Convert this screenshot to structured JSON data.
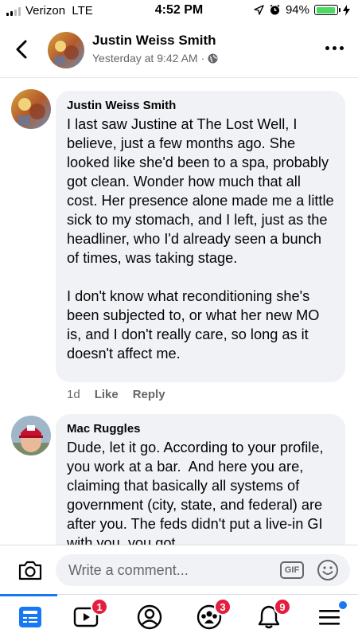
{
  "status_bar": {
    "carrier": "Verizon",
    "network": "LTE",
    "time": "4:52 PM",
    "battery": "94%",
    "battery_level": 0.94
  },
  "header": {
    "name": "Justin Weiss Smith",
    "timestamp": "Yesterday at 9:42 AM",
    "separator": "·",
    "privacy_icon": "globe-icon"
  },
  "comments": [
    {
      "author": "Justin Weiss Smith",
      "text": "I last saw Justine at The Lost Well, I believe, just a few months ago. She looked like she'd been to a spa, probably got clean. Wonder how much that all cost. Her presence alone made me a little sick to my stomach, and I left, just as the headliner, who I'd already seen a bunch of times, was taking stage.\n\nI don't know what reconditioning she's been subjected to, or what her new MO is, and I don't really care, so long as it doesn't affect me.",
      "age": "1d",
      "like_label": "Like",
      "reply_label": "Reply"
    },
    {
      "author": "Mac Ruggles",
      "text": "Dude, let it go. According to your profile, you work at a bar.  And here you are, claiming that basically all systems of government (city, state, and federal) are after you. The feds didn't put a live-in GI with you, you got"
    }
  ],
  "composer": {
    "placeholder": "Write a comment...",
    "gif_label": "GIF"
  },
  "tabbar": {
    "tabs": [
      {
        "icon": "news-feed-icon",
        "badge": ""
      },
      {
        "icon": "watch-icon",
        "badge": "1"
      },
      {
        "icon": "profile-icon",
        "badge": ""
      },
      {
        "icon": "groups-icon",
        "badge": "3"
      },
      {
        "icon": "notifications-icon",
        "badge": "9"
      },
      {
        "icon": "menu-icon",
        "badge": ""
      }
    ]
  },
  "colors": {
    "accent": "#1877f2",
    "badge": "#e41e3f",
    "bubble": "#f0f2f5",
    "secondary_text": "#65676b"
  }
}
